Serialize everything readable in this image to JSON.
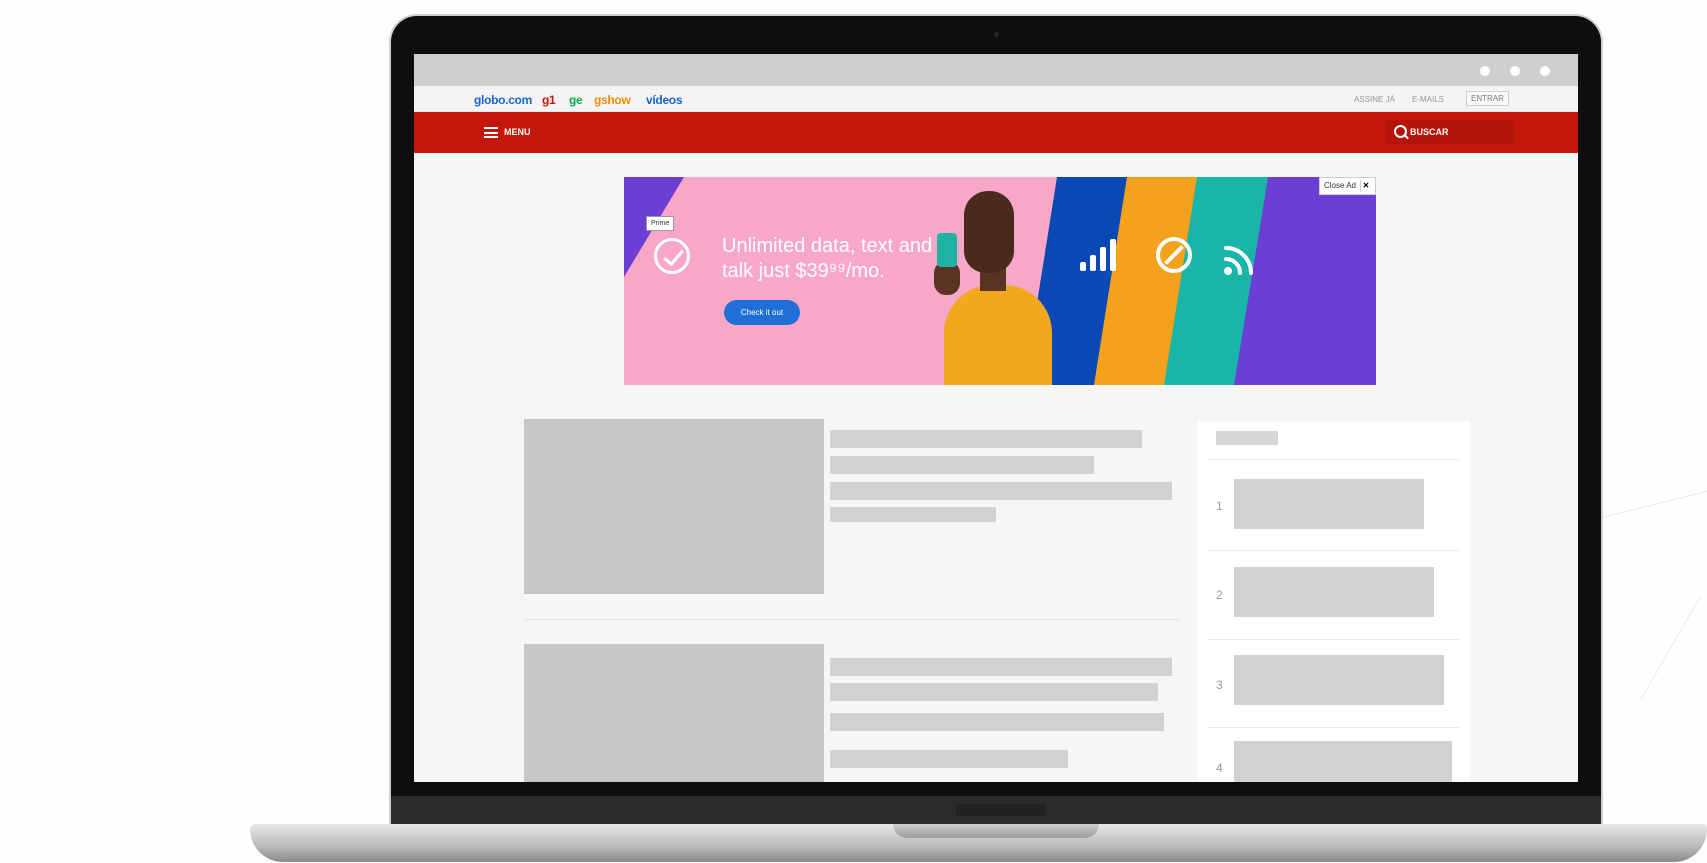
{
  "portal_links": [
    {
      "label": "globo.com",
      "color": "#1a64c8"
    },
    {
      "label": "g1",
      "color": "#c4170c"
    },
    {
      "label": "ge",
      "color": "#06aa48"
    },
    {
      "label": "gshow",
      "color": "#f28c00"
    },
    {
      "label": "vídeos",
      "color": "#1a64c8"
    }
  ],
  "topbar_right": {
    "assine": "ASSINE JÁ",
    "emails": "E-MAILS",
    "entrar": "ENTRAR"
  },
  "navbar": {
    "menu_label": "MENU",
    "search_label": "BUSCAR",
    "bg_color": "#c4170c"
  },
  "ad": {
    "close_label": "Close Ad",
    "close_x": "✕",
    "tag": "Prime",
    "headline": "Unlimited data, text and talk just $39⁹⁹/mo.",
    "cta": "Check it out",
    "stripe_colors": [
      "#0a48b5",
      "#f4a11c",
      "#19b5a9",
      "#6b3fd4"
    ],
    "icons": [
      "signal-bars-icon",
      "no-sign-icon",
      "wifi-icon"
    ]
  },
  "sidebar": {
    "numbers": [
      "1",
      "2",
      "3",
      "4"
    ]
  }
}
